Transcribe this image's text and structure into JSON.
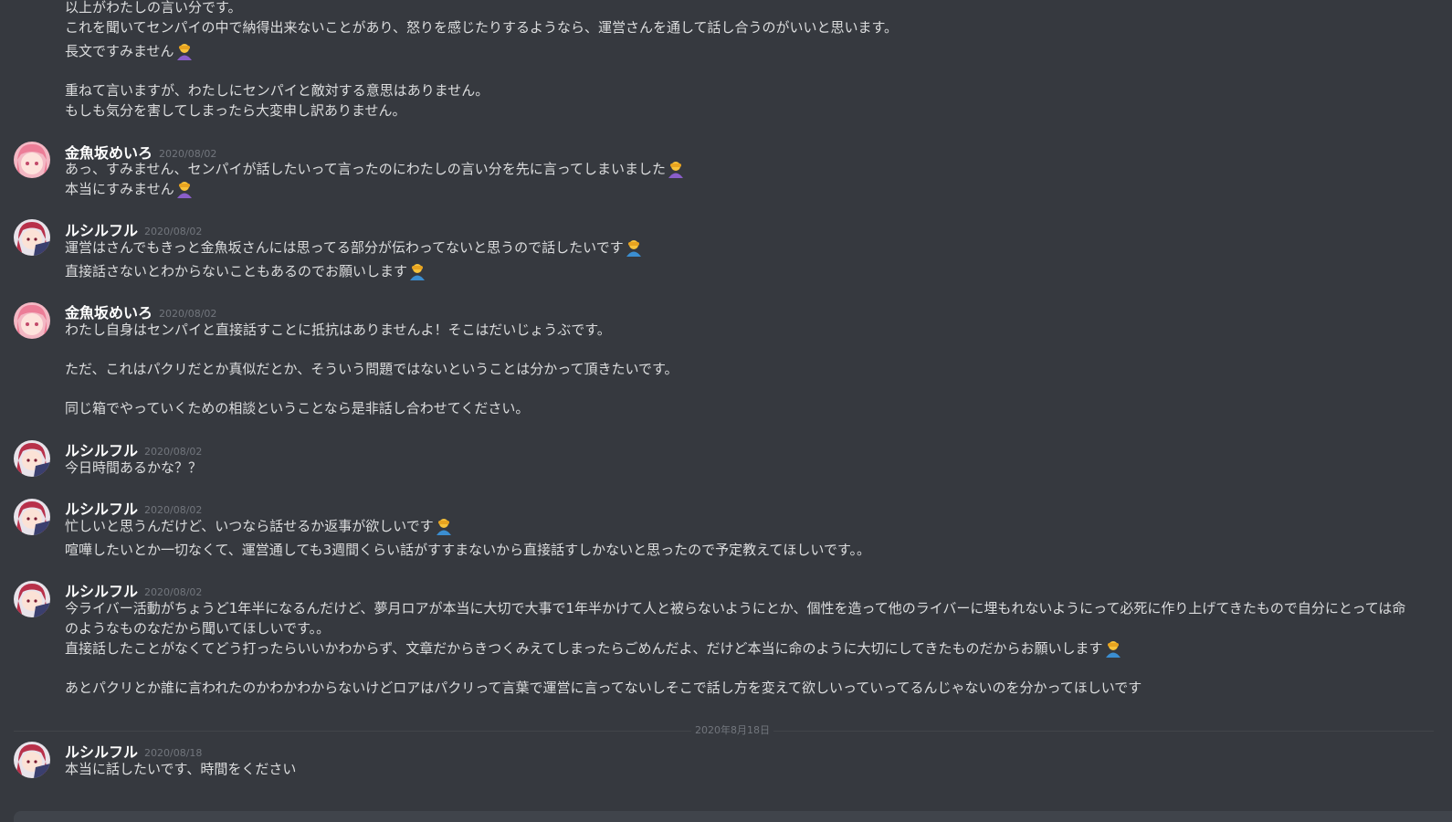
{
  "colors": {
    "background": "#36393f",
    "author": "#ffffff",
    "message_text": "#dcddde",
    "timestamp": "#72767d",
    "divider": "#42454a"
  },
  "continuation": {
    "lines": [
      "以上がわたしの言い分です。",
      "これを聞いてセンパイの中で納得出来ないことがあり、怒りを感じたりするようなら、運営さんを通して話し合うのがいいと思います。",
      "長文ですみません",
      "重ねて言いますが、わたしにセンパイと敵対する意思はありません。",
      "もしも気分を害してしまったら大変申し訳ありません。"
    ],
    "emoji_after_line_3": "person-bowing-emoji"
  },
  "messages": [
    {
      "author": "金魚坂めいろ",
      "timestamp": "2020/08/02",
      "avatar": "pink-hair-avatar",
      "lines": [
        "あっ、すみません、センパイが話したいって言ったのにわたしの言い分を先に言ってしまいました",
        "本当にすみません"
      ]
    },
    {
      "author": "ルシルフル",
      "timestamp": "2020/08/02",
      "avatar": "red-hair-avatar",
      "lines": [
        "運営はさんでもきっと金魚坂さんには思ってる部分が伝わってないと思うので話したいです",
        "直接話さないとわからないこともあるのでお願いします"
      ]
    },
    {
      "author": "金魚坂めいろ",
      "timestamp": "2020/08/02",
      "avatar": "pink-hair-avatar",
      "lines": [
        "わたし自身はセンパイと直接話すことに抵抗はありませんよ！そこはだいじょうぶです。",
        "ただ、これはパクリだとか真似だとか、そういう問題ではないということは分かって頂きたいです。",
        "同じ箱でやっていくための相談ということなら是非話し合わせてください。"
      ]
    },
    {
      "author": "ルシルフル",
      "timestamp": "2020/08/02",
      "avatar": "red-hair-avatar",
      "lines": [
        "今日時間あるかな？？"
      ]
    },
    {
      "author": "ルシルフル",
      "timestamp": "2020/08/02",
      "avatar": "red-hair-avatar",
      "lines": [
        "忙しいと思うんだけど、いつなら話せるか返事が欲しいです",
        "喧嘩したいとか一切なくて、運営通しても3週間くらい話がすすまないから直接話すしかないと思ったので予定教えてほしいです。。"
      ]
    },
    {
      "author": "ルシルフル",
      "timestamp": "2020/08/02",
      "avatar": "red-hair-avatar",
      "lines": [
        "今ライバー活動がちょうど1年半になるんだけど、夢月ロアが本当に大切で大事で1年半かけて人と被らないようにとか、個性を造って他のライバーに埋もれないようにって必死に作り上げてきたもので自分にとっては命のようなものなだから聞いてほしいです。。",
        "直接話したことがなくてどう打ったらいいかわからず、文章だからきつくみえてしまったらごめんだよ、だけど本当に命のように大切にしてきたものだからお願いします",
        "あとパクリとか誰に言われたのかわかわからないけどロアはパクリって言葉で運営に言ってないしそこで話し方を変えて欲しいっていってるんじゃないのを分かってほしいです"
      ]
    },
    {
      "author": "ルシルフル",
      "timestamp": "2020/08/18",
      "avatar": "red-hair-avatar",
      "lines": [
        "本当に話したいです、時間をください"
      ]
    }
  ],
  "date_divider": "2020年8月18日"
}
